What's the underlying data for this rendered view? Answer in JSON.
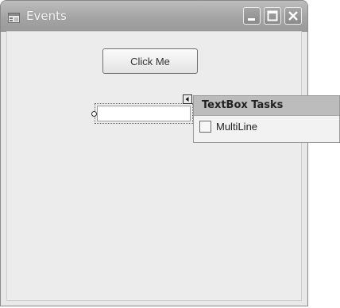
{
  "window": {
    "title": "Events"
  },
  "form": {
    "button_label": "Click Me",
    "textbox_value": ""
  },
  "tasks_panel": {
    "title": "TextBox Tasks",
    "multiline_label": "MultiLine",
    "multiline_checked": false
  },
  "icons": {
    "app": "form-icon",
    "minimize": "minimize-icon",
    "maximize": "maximize-icon",
    "close": "close-icon",
    "smart_tag": "smart-tag-arrow-icon"
  }
}
